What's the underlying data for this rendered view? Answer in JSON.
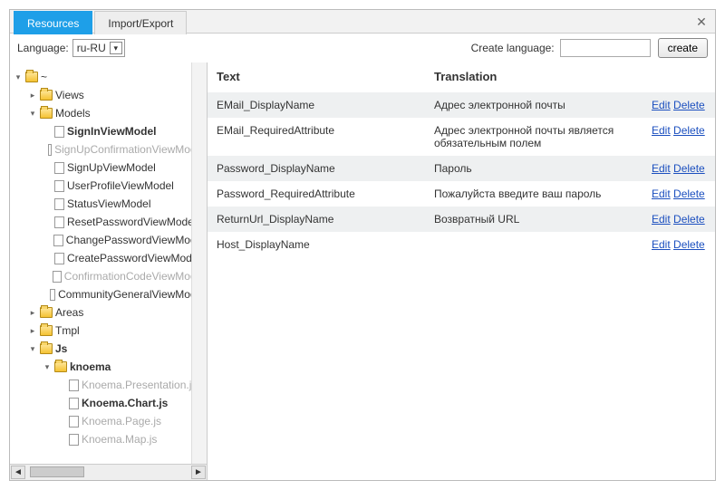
{
  "tabs": [
    {
      "label": "Resources",
      "active": true
    },
    {
      "label": "Import/Export",
      "active": false
    }
  ],
  "close_x": "✕",
  "toolbar": {
    "language_label": "Language:",
    "language_value": "ru-RU",
    "create_language_label": "Create language:",
    "create_language_value": "",
    "create_button": "create"
  },
  "tree": [
    {
      "label": "~",
      "icon": "folder-open",
      "toggle": "▾",
      "depth": 0,
      "bold": false,
      "dim": false
    },
    {
      "label": "Views",
      "icon": "folder-closed",
      "toggle": "▸",
      "depth": 1,
      "bold": false,
      "dim": false
    },
    {
      "label": "Models",
      "icon": "folder-open",
      "toggle": "▾",
      "depth": 1,
      "bold": false,
      "dim": false
    },
    {
      "label": "SignInViewModel",
      "icon": "file",
      "toggle": "",
      "depth": 2,
      "bold": true,
      "dim": false
    },
    {
      "label": "SignUpConfirmationViewModel",
      "icon": "file",
      "toggle": "",
      "depth": 2,
      "bold": false,
      "dim": true
    },
    {
      "label": "SignUpViewModel",
      "icon": "file",
      "toggle": "",
      "depth": 2,
      "bold": false,
      "dim": false
    },
    {
      "label": "UserProfileViewModel",
      "icon": "file",
      "toggle": "",
      "depth": 2,
      "bold": false,
      "dim": false
    },
    {
      "label": "StatusViewModel",
      "icon": "file",
      "toggle": "",
      "depth": 2,
      "bold": false,
      "dim": false
    },
    {
      "label": "ResetPasswordViewModel",
      "icon": "file",
      "toggle": "",
      "depth": 2,
      "bold": false,
      "dim": false
    },
    {
      "label": "ChangePasswordViewModel",
      "icon": "file",
      "toggle": "",
      "depth": 2,
      "bold": false,
      "dim": false
    },
    {
      "label": "CreatePasswordViewModel",
      "icon": "file",
      "toggle": "",
      "depth": 2,
      "bold": false,
      "dim": false
    },
    {
      "label": "ConfirmationCodeViewModel",
      "icon": "file",
      "toggle": "",
      "depth": 2,
      "bold": false,
      "dim": true
    },
    {
      "label": "CommunityGeneralViewModel",
      "icon": "file",
      "toggle": "",
      "depth": 2,
      "bold": false,
      "dim": false
    },
    {
      "label": "Areas",
      "icon": "folder-closed",
      "toggle": "▸",
      "depth": 1,
      "bold": false,
      "dim": false
    },
    {
      "label": "Tmpl",
      "icon": "folder-closed",
      "toggle": "▸",
      "depth": 1,
      "bold": false,
      "dim": false
    },
    {
      "label": "Js",
      "icon": "folder-open",
      "toggle": "▾",
      "depth": 1,
      "bold": true,
      "dim": false
    },
    {
      "label": "knoema",
      "icon": "folder-open",
      "toggle": "▾",
      "depth": 2,
      "bold": true,
      "dim": false
    },
    {
      "label": "Knoema.Presentation.js",
      "icon": "file",
      "toggle": "",
      "depth": 3,
      "bold": false,
      "dim": true
    },
    {
      "label": "Knoema.Chart.js",
      "icon": "file",
      "toggle": "",
      "depth": 3,
      "bold": true,
      "dim": false
    },
    {
      "label": "Knoema.Page.js",
      "icon": "file",
      "toggle": "",
      "depth": 3,
      "bold": false,
      "dim": true
    },
    {
      "label": "Knoema.Map.js",
      "icon": "file",
      "toggle": "",
      "depth": 3,
      "bold": false,
      "dim": true
    }
  ],
  "table": {
    "headers": {
      "text": "Text",
      "translation": "Translation"
    },
    "edit": "Edit",
    "delete": "Delete",
    "rows": [
      {
        "text": "EMail_DisplayName",
        "translation": "Адрес электронной почты"
      },
      {
        "text": "EMail_RequiredAttribute",
        "translation": "Адрес электронной почты является обязательным полем"
      },
      {
        "text": "Password_DisplayName",
        "translation": "Пароль"
      },
      {
        "text": "Password_RequiredAttribute",
        "translation": "Пожалуйста введите ваш пароль"
      },
      {
        "text": "ReturnUrl_DisplayName",
        "translation": "Возвратный URL"
      },
      {
        "text": "Host_DisplayName",
        "translation": ""
      }
    ]
  }
}
